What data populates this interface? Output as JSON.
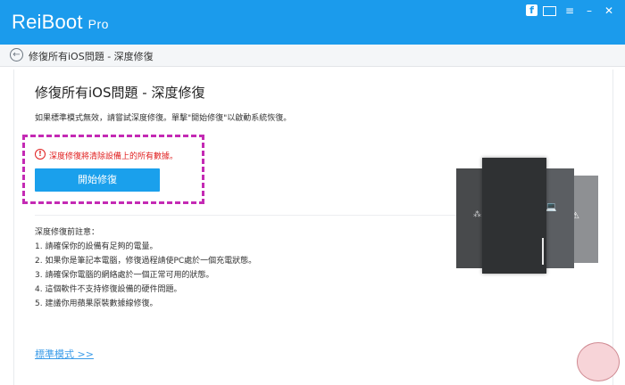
{
  "app": {
    "name": "ReiBoot",
    "edition": "Pro"
  },
  "window_icons": {
    "facebook": "f",
    "mail": "mail-icon",
    "menu": "≡",
    "minimize": "–",
    "close": "✕"
  },
  "breadcrumb": {
    "label": "修復所有iOS問題 - 深度修復"
  },
  "main": {
    "title": "修復所有iOS問題 - 深度修復",
    "description": "如果標準模式無效，請嘗試深度修復。單擊\"開始修復\"以啟動系統恢復。",
    "warning": "深度修復將清除設備上的所有數據。",
    "start_button": "開始修復",
    "notes_title": "深度修復前註意：",
    "notes": [
      "1. 請確保你的設備有足夠的電量。",
      "2. 如果你是筆記本電腦，修復過程請使PC處於一個充電狀態。",
      "3. 請確保你電腦的網絡處於一個正常可用的狀態。",
      "4. 這個軟件不支持修復設備的硬件問題。",
      "5. 建議你用蘋果原裝數據線修復。"
    ],
    "standard_mode_link": "標準模式 >>"
  },
  "colors": {
    "titlebar": "#1b9bec",
    "accent": "#1aa0ec",
    "warning": "#e02020",
    "highlight": "#c42ab4"
  }
}
